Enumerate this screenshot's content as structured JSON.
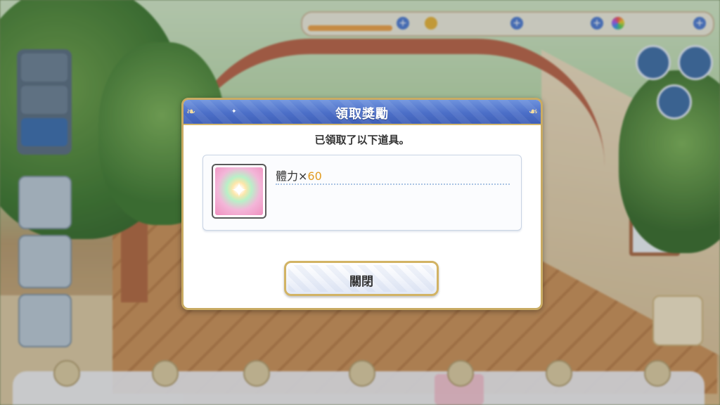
{
  "dialog": {
    "title": "領取獎勵",
    "message": "已領取了以下道具。",
    "items": [
      {
        "name": "體力",
        "multiplier": "×",
        "quantity": "60",
        "icon": "stamina-icon"
      }
    ],
    "close_label": "關閉"
  },
  "colors": {
    "header_blue": "#4c6fc8",
    "border_gold": "#c9ab63",
    "quantity_orange": "#e29b1f"
  }
}
